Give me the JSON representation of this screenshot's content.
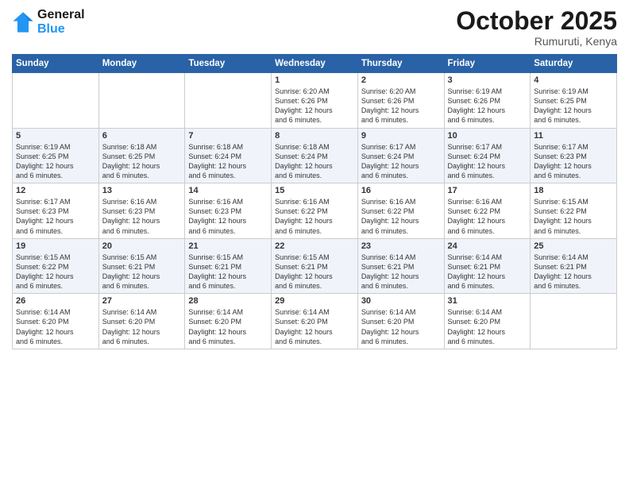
{
  "header": {
    "logo_line1": "General",
    "logo_line2": "Blue",
    "month": "October 2025",
    "location": "Rumuruti, Kenya"
  },
  "weekdays": [
    "Sunday",
    "Monday",
    "Tuesday",
    "Wednesday",
    "Thursday",
    "Friday",
    "Saturday"
  ],
  "weeks": [
    [
      {
        "day": "",
        "info": ""
      },
      {
        "day": "",
        "info": ""
      },
      {
        "day": "",
        "info": ""
      },
      {
        "day": "1",
        "info": "Sunrise: 6:20 AM\nSunset: 6:26 PM\nDaylight: 12 hours\nand 6 minutes."
      },
      {
        "day": "2",
        "info": "Sunrise: 6:20 AM\nSunset: 6:26 PM\nDaylight: 12 hours\nand 6 minutes."
      },
      {
        "day": "3",
        "info": "Sunrise: 6:19 AM\nSunset: 6:26 PM\nDaylight: 12 hours\nand 6 minutes."
      },
      {
        "day": "4",
        "info": "Sunrise: 6:19 AM\nSunset: 6:25 PM\nDaylight: 12 hours\nand 6 minutes."
      }
    ],
    [
      {
        "day": "5",
        "info": "Sunrise: 6:19 AM\nSunset: 6:25 PM\nDaylight: 12 hours\nand 6 minutes."
      },
      {
        "day": "6",
        "info": "Sunrise: 6:18 AM\nSunset: 6:25 PM\nDaylight: 12 hours\nand 6 minutes."
      },
      {
        "day": "7",
        "info": "Sunrise: 6:18 AM\nSunset: 6:24 PM\nDaylight: 12 hours\nand 6 minutes."
      },
      {
        "day": "8",
        "info": "Sunrise: 6:18 AM\nSunset: 6:24 PM\nDaylight: 12 hours\nand 6 minutes."
      },
      {
        "day": "9",
        "info": "Sunrise: 6:17 AM\nSunset: 6:24 PM\nDaylight: 12 hours\nand 6 minutes."
      },
      {
        "day": "10",
        "info": "Sunrise: 6:17 AM\nSunset: 6:24 PM\nDaylight: 12 hours\nand 6 minutes."
      },
      {
        "day": "11",
        "info": "Sunrise: 6:17 AM\nSunset: 6:23 PM\nDaylight: 12 hours\nand 6 minutes."
      }
    ],
    [
      {
        "day": "12",
        "info": "Sunrise: 6:17 AM\nSunset: 6:23 PM\nDaylight: 12 hours\nand 6 minutes."
      },
      {
        "day": "13",
        "info": "Sunrise: 6:16 AM\nSunset: 6:23 PM\nDaylight: 12 hours\nand 6 minutes."
      },
      {
        "day": "14",
        "info": "Sunrise: 6:16 AM\nSunset: 6:23 PM\nDaylight: 12 hours\nand 6 minutes."
      },
      {
        "day": "15",
        "info": "Sunrise: 6:16 AM\nSunset: 6:22 PM\nDaylight: 12 hours\nand 6 minutes."
      },
      {
        "day": "16",
        "info": "Sunrise: 6:16 AM\nSunset: 6:22 PM\nDaylight: 12 hours\nand 6 minutes."
      },
      {
        "day": "17",
        "info": "Sunrise: 6:16 AM\nSunset: 6:22 PM\nDaylight: 12 hours\nand 6 minutes."
      },
      {
        "day": "18",
        "info": "Sunrise: 6:15 AM\nSunset: 6:22 PM\nDaylight: 12 hours\nand 6 minutes."
      }
    ],
    [
      {
        "day": "19",
        "info": "Sunrise: 6:15 AM\nSunset: 6:22 PM\nDaylight: 12 hours\nand 6 minutes."
      },
      {
        "day": "20",
        "info": "Sunrise: 6:15 AM\nSunset: 6:21 PM\nDaylight: 12 hours\nand 6 minutes."
      },
      {
        "day": "21",
        "info": "Sunrise: 6:15 AM\nSunset: 6:21 PM\nDaylight: 12 hours\nand 6 minutes."
      },
      {
        "day": "22",
        "info": "Sunrise: 6:15 AM\nSunset: 6:21 PM\nDaylight: 12 hours\nand 6 minutes."
      },
      {
        "day": "23",
        "info": "Sunrise: 6:14 AM\nSunset: 6:21 PM\nDaylight: 12 hours\nand 6 minutes."
      },
      {
        "day": "24",
        "info": "Sunrise: 6:14 AM\nSunset: 6:21 PM\nDaylight: 12 hours\nand 6 minutes."
      },
      {
        "day": "25",
        "info": "Sunrise: 6:14 AM\nSunset: 6:21 PM\nDaylight: 12 hours\nand 6 minutes."
      }
    ],
    [
      {
        "day": "26",
        "info": "Sunrise: 6:14 AM\nSunset: 6:20 PM\nDaylight: 12 hours\nand 6 minutes."
      },
      {
        "day": "27",
        "info": "Sunrise: 6:14 AM\nSunset: 6:20 PM\nDaylight: 12 hours\nand 6 minutes."
      },
      {
        "day": "28",
        "info": "Sunrise: 6:14 AM\nSunset: 6:20 PM\nDaylight: 12 hours\nand 6 minutes."
      },
      {
        "day": "29",
        "info": "Sunrise: 6:14 AM\nSunset: 6:20 PM\nDaylight: 12 hours\nand 6 minutes."
      },
      {
        "day": "30",
        "info": "Sunrise: 6:14 AM\nSunset: 6:20 PM\nDaylight: 12 hours\nand 6 minutes."
      },
      {
        "day": "31",
        "info": "Sunrise: 6:14 AM\nSunset: 6:20 PM\nDaylight: 12 hours\nand 6 minutes."
      },
      {
        "day": "",
        "info": ""
      }
    ]
  ]
}
